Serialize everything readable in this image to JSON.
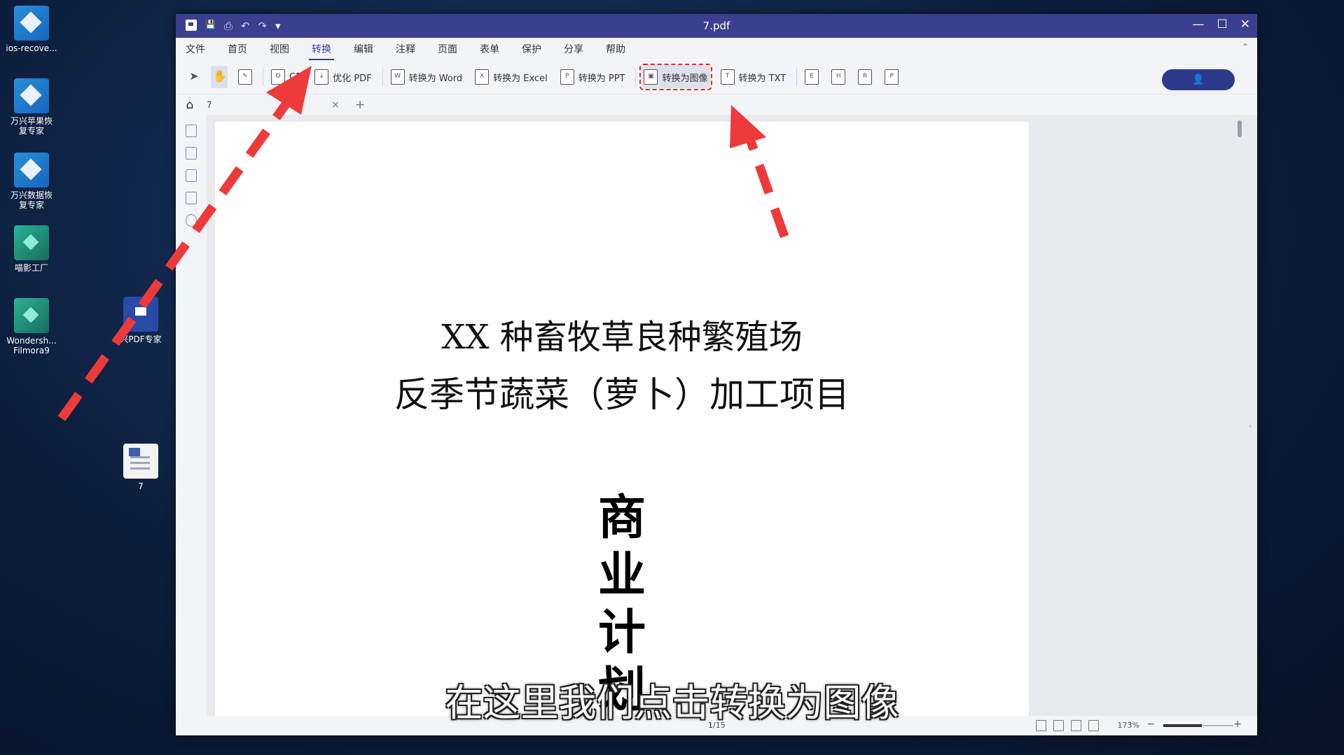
{
  "desktop": {
    "icons": [
      {
        "label": "ios-recove...",
        "kind": "blue"
      },
      {
        "label": "万兴苹果恢复专家",
        "kind": "blue"
      },
      {
        "label": "万兴数据恢复专家",
        "kind": "blue"
      },
      {
        "label": "喵影工厂",
        "kind": "green"
      },
      {
        "label": "Wondersh... Filmora9",
        "kind": "green"
      },
      {
        "label": "兴PDF专家",
        "kind": "pdf"
      },
      {
        "label": "7",
        "kind": "doc"
      }
    ]
  },
  "window": {
    "title": "7.pdf",
    "controls": {
      "minimize": "—",
      "maximize": "☐",
      "close": "✕"
    },
    "quick_access": {
      "save": "💾",
      "print": "⎙",
      "undo": "↶",
      "redo": "↷",
      "customize": "▾"
    },
    "menu": [
      "文件",
      "首页",
      "视图",
      "转换",
      "编辑",
      "注释",
      "页面",
      "表单",
      "保护",
      "分享",
      "帮助"
    ],
    "active_menu": "转换",
    "collapse": "⌃",
    "toolbar": {
      "ocr_label": "CR",
      "optimize_label": "优化 PDF",
      "to_word": "转换为 Word",
      "to_excel": "转换为 Excel",
      "to_ppt": "转换为 PPT",
      "to_image": "转换为图像",
      "to_txt": "转换为 TXT"
    },
    "login_icon": "👤",
    "tab": {
      "name": "7",
      "close": "×",
      "add": "+"
    },
    "document": {
      "title_line1": "XX 种畜牧草良种繁殖场",
      "title_line2": "反季节蔬菜（萝卜）加工项目",
      "vertical_chars": [
        "商",
        "业",
        "计",
        "划"
      ]
    },
    "status": {
      "page_current": "1",
      "page_total": "/15",
      "zoom": "173%",
      "zoom_minus": "−",
      "zoom_plus": "+"
    }
  },
  "subtitle": "在这里我们点击转换为图像",
  "colors": {
    "accent": "#3a3f8f",
    "highlight": "#e02a2a",
    "arrow": "#ee3a3a"
  }
}
